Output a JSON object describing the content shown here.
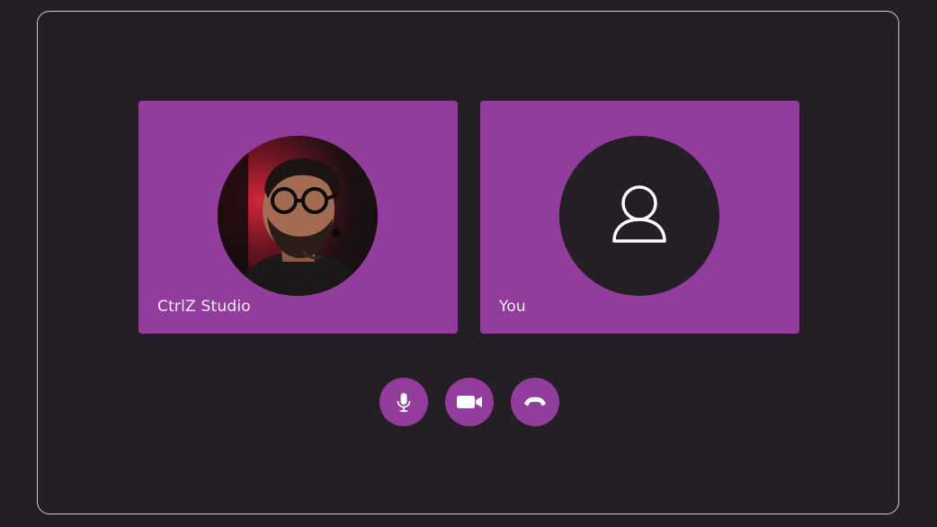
{
  "call": {
    "participants": [
      {
        "name": "CtrlZ Studio",
        "avatar": "photo"
      },
      {
        "name": "You",
        "avatar": "user-icon"
      }
    ],
    "controls": [
      {
        "icon": "microphone-icon",
        "label": "Microphone"
      },
      {
        "icon": "video-camera-icon",
        "label": "Camera"
      },
      {
        "icon": "end-call-icon",
        "label": "End call"
      }
    ]
  },
  "colors": {
    "background": "#231f24",
    "accent": "#923c9c",
    "text": "#f4eef5",
    "frame_border": "#cfcccf"
  }
}
